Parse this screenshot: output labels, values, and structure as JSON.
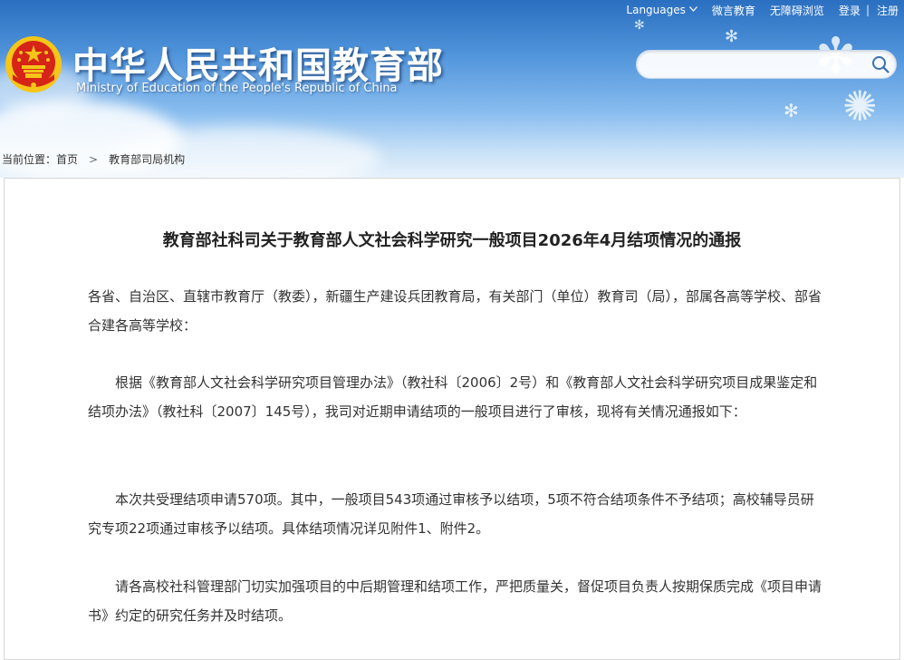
{
  "top_nav": {
    "languages": "Languages",
    "weibo": "微言教育",
    "accessible": "无障碍浏览",
    "login": "登录",
    "separator": "|",
    "register": "注册"
  },
  "header": {
    "title_cn": "中华人民共和国教育部",
    "title_en": "Ministry of Education of the People's Republic of China"
  },
  "search": {
    "placeholder": "",
    "value": ""
  },
  "breadcrumb": {
    "prefix": "当前位置：",
    "home": "首页",
    "separator": ">",
    "section": "教育部司局机构"
  },
  "article": {
    "title": "教育部社科司关于教育部人文社会科学研究一般项目2026年4月结项情况的通报",
    "paragraphs": [
      "各省、自治区、直辖市教育厅（教委），新疆生产建设兵团教育局，有关部门（单位）教育司（局），部属各高等学校、部省合建各高等学校：",
      "根据《教育部人文社会科学研究项目管理办法》（教社科〔2006〕2号）和《教育部人文社会科学研究项目成果鉴定和结项办法》（教社科〔2007〕145号），我司对近期申请结项的一般项目进行了审核，现将有关情况通报如下：",
      "本次共受理结项申请570项。其中，一般项目543项通过审核予以结项，5项不符合结项条件不予结项；高校辅导员研究专项22项通过审核予以结项。具体结项情况详见附件1、附件2。",
      "请各高校社科管理部门切实加强项目的中后期管理和结项工作，严把质量关，督促项目负责人按期保质完成《项目申请书》约定的研究任务并及时结项。"
    ]
  },
  "colors": {
    "header_top": "#2a6fc0",
    "header_bottom": "#e6f1fb",
    "text": "#333333",
    "emblem_red": "#d62418",
    "emblem_gold": "#f5c518"
  },
  "icons": {
    "emblem": "national-emblem-icon",
    "search": "search-icon",
    "chevron": "chevron-down-icon"
  }
}
